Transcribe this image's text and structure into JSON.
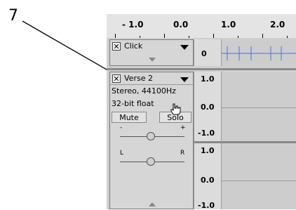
{
  "callout": {
    "number": "7"
  },
  "ruler": {
    "labels": [
      "- 1.0",
      "0.0",
      "1.0",
      "2.0"
    ]
  },
  "tracks": [
    {
      "name": "Click",
      "vscale": [
        "0"
      ]
    },
    {
      "name": "Verse 2",
      "info_line1": "Stereo, 44100Hz",
      "info_line2": "32-bit float",
      "mute_label": "Mute",
      "solo_label": "Solo",
      "gain_minus": "-",
      "gain_plus": "+",
      "pan_left": "L",
      "pan_right": "R",
      "vscale_top": [
        "1.0",
        "0.0",
        "-1.0"
      ],
      "vscale_bottom": [
        "1.0",
        "0.0",
        "-1.0"
      ]
    }
  ],
  "colors": {
    "panel": "#d6d6d6",
    "wave_bg": "#cdcdcd",
    "click_ticks": "#4d6ed6"
  },
  "icons": [
    "close-icon",
    "dropdown-arrow-icon",
    "hand-cursor-icon"
  ]
}
